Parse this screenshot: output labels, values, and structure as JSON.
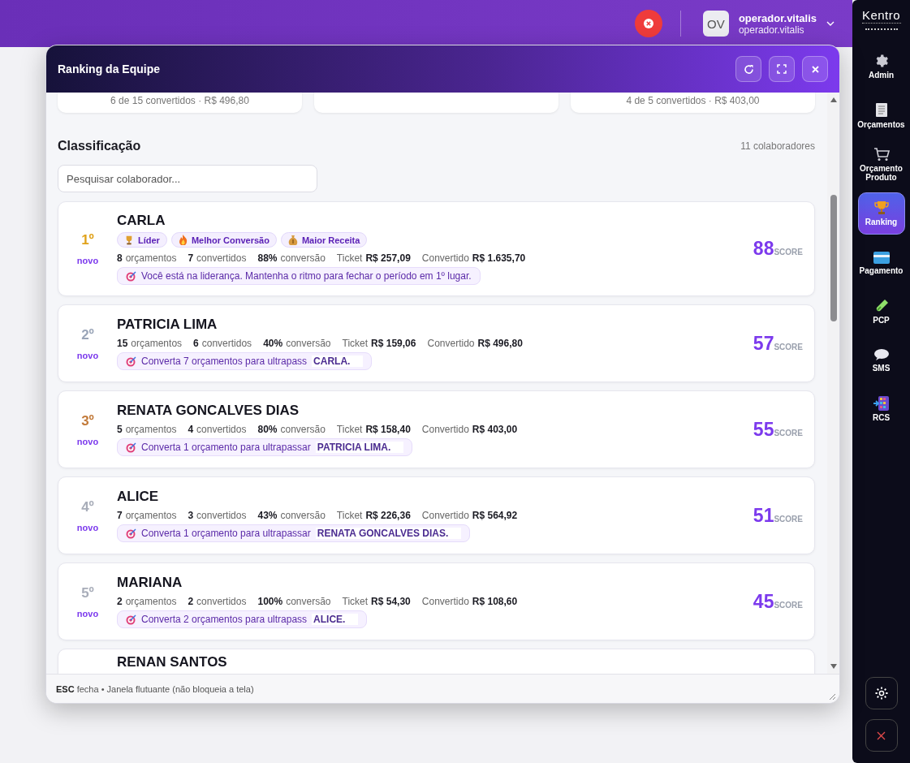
{
  "topbar": {
    "avatar": "OV",
    "user_name": "operador.vitalis",
    "user_login": "operador.vitalis"
  },
  "sidebar": {
    "logo": "Kentro",
    "items": [
      {
        "kind": "gear",
        "label": "Admin",
        "selected": false
      },
      {
        "kind": "document",
        "label": "Orçamentos",
        "selected": false
      },
      {
        "kind": "cart",
        "label": "Orçamento Produto",
        "selected": false
      },
      {
        "kind": "trophy",
        "label": "Ranking",
        "selected": true
      },
      {
        "kind": "card",
        "label": "Pagamento",
        "selected": false
      },
      {
        "kind": "tube",
        "label": "PCP",
        "selected": false
      },
      {
        "kind": "bubble",
        "label": "SMS",
        "selected": false
      },
      {
        "kind": "grid",
        "label": "RCS",
        "selected": false
      }
    ]
  },
  "window": {
    "title": "Ranking da Equipe",
    "summary_cards": [
      {
        "text": "6 de 15 convertidos · R$ 496,80"
      },
      {
        "covered": true
      },
      {
        "text": "4 de 5 convertidos · R$ 403,00"
      }
    ],
    "section_title": "Classificação",
    "count": "11 colaboradores",
    "search": {
      "placeholder": "Pesquisar colaborador..."
    },
    "rows": [
      {
        "rank": "1º",
        "color": "#e0a21a",
        "tag": "novo",
        "name": "CARLA",
        "badges": [
          {
            "kind": "trophy",
            "label": "Líder"
          },
          {
            "kind": "fire",
            "label": "Melhor Conversão"
          },
          {
            "kind": "moneybag",
            "label": "Maior Receita"
          }
        ],
        "stats": [
          {
            "kind": "count",
            "value": "8",
            "unit": "orçamentos"
          },
          {
            "kind": "count",
            "value": "7",
            "unit": "convertidos"
          },
          {
            "kind": "count",
            "value": "88%",
            "unit": "conversão"
          },
          {
            "kind": "money",
            "label": "Ticket",
            "value": "R$ 257,09"
          },
          {
            "kind": "money",
            "label": "Convertido",
            "value": "R$ 1.635,70"
          }
        ],
        "message": "Você está na liderança. Mantenha o ritmo para fechar o período em 1º lugar.",
        "score": "88",
        "score_label": "SCORE"
      },
      {
        "rank": "2º",
        "color": "#9aa5b8",
        "tag": "novo",
        "name": "PATRICIA LIMA",
        "stats": [
          {
            "kind": "count",
            "value": "15",
            "unit": "orçamentos"
          },
          {
            "kind": "count",
            "value": "6",
            "unit": "convertidos"
          },
          {
            "kind": "count",
            "value": "40%",
            "unit": "conversão"
          },
          {
            "kind": "money",
            "label": "Ticket",
            "value": "R$ 159,06"
          },
          {
            "kind": "money",
            "label": "Convertido",
            "value": "R$ 496,80"
          }
        ],
        "message": "Converta 7 orçamentos para ultrapass",
        "target": "CARLA.",
        "score": "57",
        "score_label": "SCORE"
      },
      {
        "rank": "3º",
        "color": "#c27a3a",
        "tag": "novo",
        "name": "RENATA GONCALVES DIAS",
        "stats": [
          {
            "kind": "count",
            "value": "5",
            "unit": "orçamentos"
          },
          {
            "kind": "count",
            "value": "4",
            "unit": "convertidos"
          },
          {
            "kind": "count",
            "value": "80%",
            "unit": "conversão"
          },
          {
            "kind": "money",
            "label": "Ticket",
            "value": "R$ 158,40"
          },
          {
            "kind": "money",
            "label": "Convertido",
            "value": "R$ 403,00"
          }
        ],
        "message": "Converta 1 orçamento para ultrapassar",
        "target": "PATRICIA LIMA.",
        "score": "55",
        "score_label": "SCORE"
      },
      {
        "rank": "4º",
        "color": "#a8adb9",
        "tag": "novo",
        "name": "ALICE",
        "stats": [
          {
            "kind": "count",
            "value": "7",
            "unit": "orçamentos"
          },
          {
            "kind": "count",
            "value": "3",
            "unit": "convertidos"
          },
          {
            "kind": "count",
            "value": "43%",
            "unit": "conversão"
          },
          {
            "kind": "money",
            "label": "Ticket",
            "value": "R$ 226,36"
          },
          {
            "kind": "money",
            "label": "Convertido",
            "value": "R$ 564,92"
          }
        ],
        "message": "Converta 1 orçamento para ultrapassar",
        "target": "RENATA GONCALVES DIAS.",
        "score": "51",
        "score_label": "SCORE"
      },
      {
        "rank": "5º",
        "color": "#a8adb9",
        "tag": "novo",
        "name": "MARIANA",
        "stats": [
          {
            "kind": "count",
            "value": "2",
            "unit": "orçamentos"
          },
          {
            "kind": "count",
            "value": "2",
            "unit": "convertidos"
          },
          {
            "kind": "count",
            "value": "100%",
            "unit": "conversão"
          },
          {
            "kind": "money",
            "label": "Ticket",
            "value": "R$ 54,30"
          },
          {
            "kind": "money",
            "label": "Convertido",
            "value": "R$ 108,60"
          }
        ],
        "message": "Converta 2 orçamentos para ultrapass",
        "target": "ALICE.",
        "score": "45",
        "score_label": "SCORE"
      },
      {
        "name": "RENAN SANTOS"
      }
    ],
    "footer": "**ESC** fecha • Janela flutuante (não bloqueia a tela)"
  }
}
